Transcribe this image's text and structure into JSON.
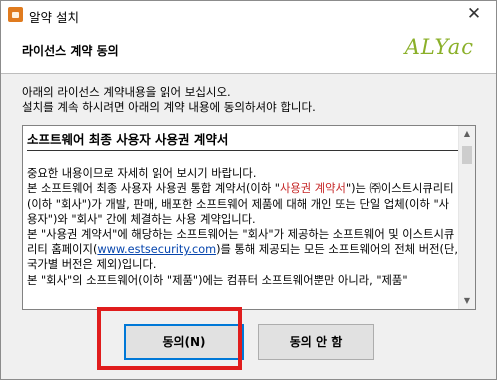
{
  "window": {
    "title": "알약 설치",
    "close_symbol": "✕"
  },
  "header": {
    "title": "라이선스 계약 동의",
    "logo_text": "ALYac",
    "logo_color": "#8bb02a"
  },
  "instructions": [
    "아래의 라이선스 계약내용을 읽어 보십시오.",
    "설치를 계속 하시려면 아래의 계약 내용에 동의하셔야 합니다."
  ],
  "license": {
    "heading": "소프트웨어 최종 사용자 사용권 계약서",
    "para1": "중요한 내용이므로 자세히 읽어 보시기 바랍니다.",
    "para2_a": "본 소프트웨어 최종 사용자 사용권 통합 계약서(이하 \"",
    "para2_red": "사용권 계약서",
    "para2_b": "\")는 ㈜이스트시큐리티(이하 \"회사\")가 개발, 판매, 배포한 소프트웨어 제품에 대해 개인 또는 단일 업체(이하 \"사용자\")와 \"회사\" 간에 체결하는 사용 계약입니다.",
    "para3_a": "본 \"사용권 계약서\"에 해당하는 소프트웨어는 \"회사\"가 제공하는 소프트웨어 및 이스트시큐리티 홈페이지(",
    "para3_link": "www.estsecurity.com",
    "para3_b": ")를 통해 제공되는 모든 소프트웨어의 전체 버전(단, 국가별 버전은 제외)입니다.",
    "para4": "본 \"회사\"의 소프트웨어(이하 \"제품\")에는 컴퓨터 소프트웨어뿐만 아니라, \"제품\""
  },
  "buttons": {
    "agree": "동의(N)",
    "disagree": "동의 안 함"
  },
  "scrollbar": {
    "up_icon": "▲",
    "down_icon": "▼"
  },
  "colors": {
    "highlight": "#e01c1c",
    "link": "#0645ad",
    "emphasis": "#c62828",
    "focus": "#0078d7"
  }
}
